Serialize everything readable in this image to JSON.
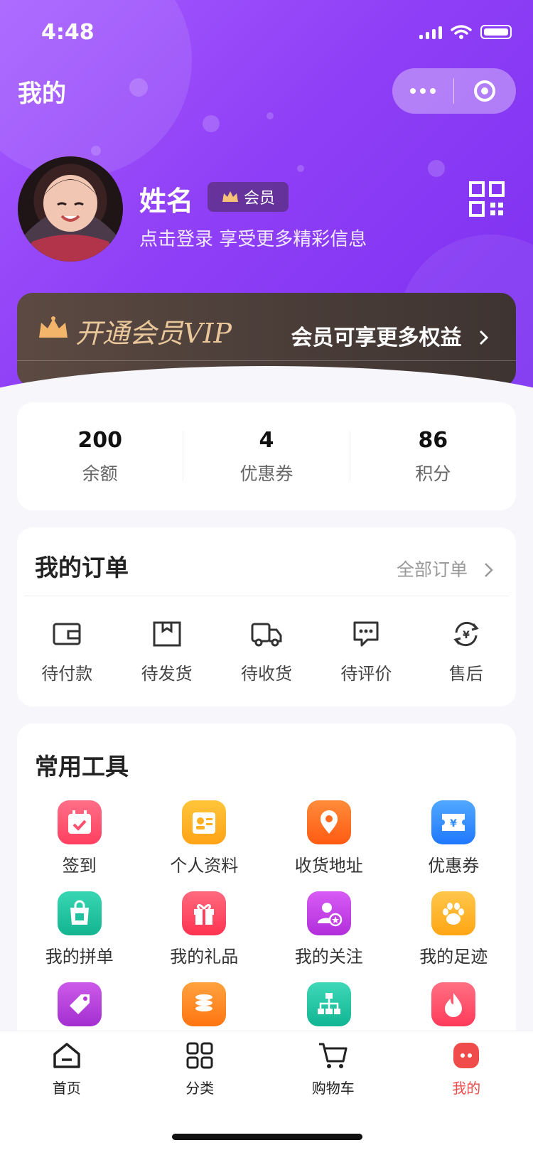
{
  "status_bar": {
    "time": "4:48"
  },
  "header": {
    "title": "我的"
  },
  "profile": {
    "name": "姓名",
    "badge": "会员",
    "subtitle": "点击登录 享受更多精彩信息"
  },
  "vip": {
    "title": "开通会员VIP",
    "link": "会员可享更多权益"
  },
  "stats": [
    {
      "value": "200",
      "label": "余额"
    },
    {
      "value": "4",
      "label": "优惠券"
    },
    {
      "value": "86",
      "label": "积分"
    }
  ],
  "orders": {
    "title": "我的订单",
    "all": "全部订单",
    "items": [
      {
        "label": "待付款",
        "icon": "wallet-icon"
      },
      {
        "label": "待发货",
        "icon": "box-icon"
      },
      {
        "label": "待收货",
        "icon": "truck-icon"
      },
      {
        "label": "待评价",
        "icon": "chat-icon"
      },
      {
        "label": "售后",
        "icon": "refund-icon"
      }
    ]
  },
  "tools": {
    "title": "常用工具",
    "items": [
      {
        "label": "签到",
        "icon": "calendar-check-icon",
        "color": "#ff4f6f"
      },
      {
        "label": "个人资料",
        "icon": "id-card-icon",
        "color": "#ffb020"
      },
      {
        "label": "收货地址",
        "icon": "location-pin-icon",
        "color": "#ff6a1f"
      },
      {
        "label": "优惠券",
        "icon": "coupon-icon",
        "color": "#2f8cff"
      },
      {
        "label": "我的拼单",
        "icon": "shopping-bag-icon",
        "color": "#1fc2a0"
      },
      {
        "label": "我的礼品",
        "icon": "gift-icon",
        "color": "#ff3f5f"
      },
      {
        "label": "我的关注",
        "icon": "user-star-icon",
        "color": "#c43ee8"
      },
      {
        "label": "我的足迹",
        "icon": "paw-icon",
        "color": "#ffb21f"
      },
      {
        "label": "",
        "icon": "tag-icon",
        "color": "#b53ad6"
      },
      {
        "label": "",
        "icon": "coins-icon",
        "color": "#ff8b1f"
      },
      {
        "label": "",
        "icon": "org-chart-icon",
        "color": "#1fc6a8"
      },
      {
        "label": "",
        "icon": "flame-icon",
        "color": "#ff4b6b"
      }
    ]
  },
  "tabbar": [
    {
      "label": "首页",
      "icon": "home-icon"
    },
    {
      "label": "分类",
      "icon": "grid-icon"
    },
    {
      "label": "购物车",
      "icon": "cart-icon"
    },
    {
      "label": "我的",
      "icon": "profile-icon"
    }
  ]
}
